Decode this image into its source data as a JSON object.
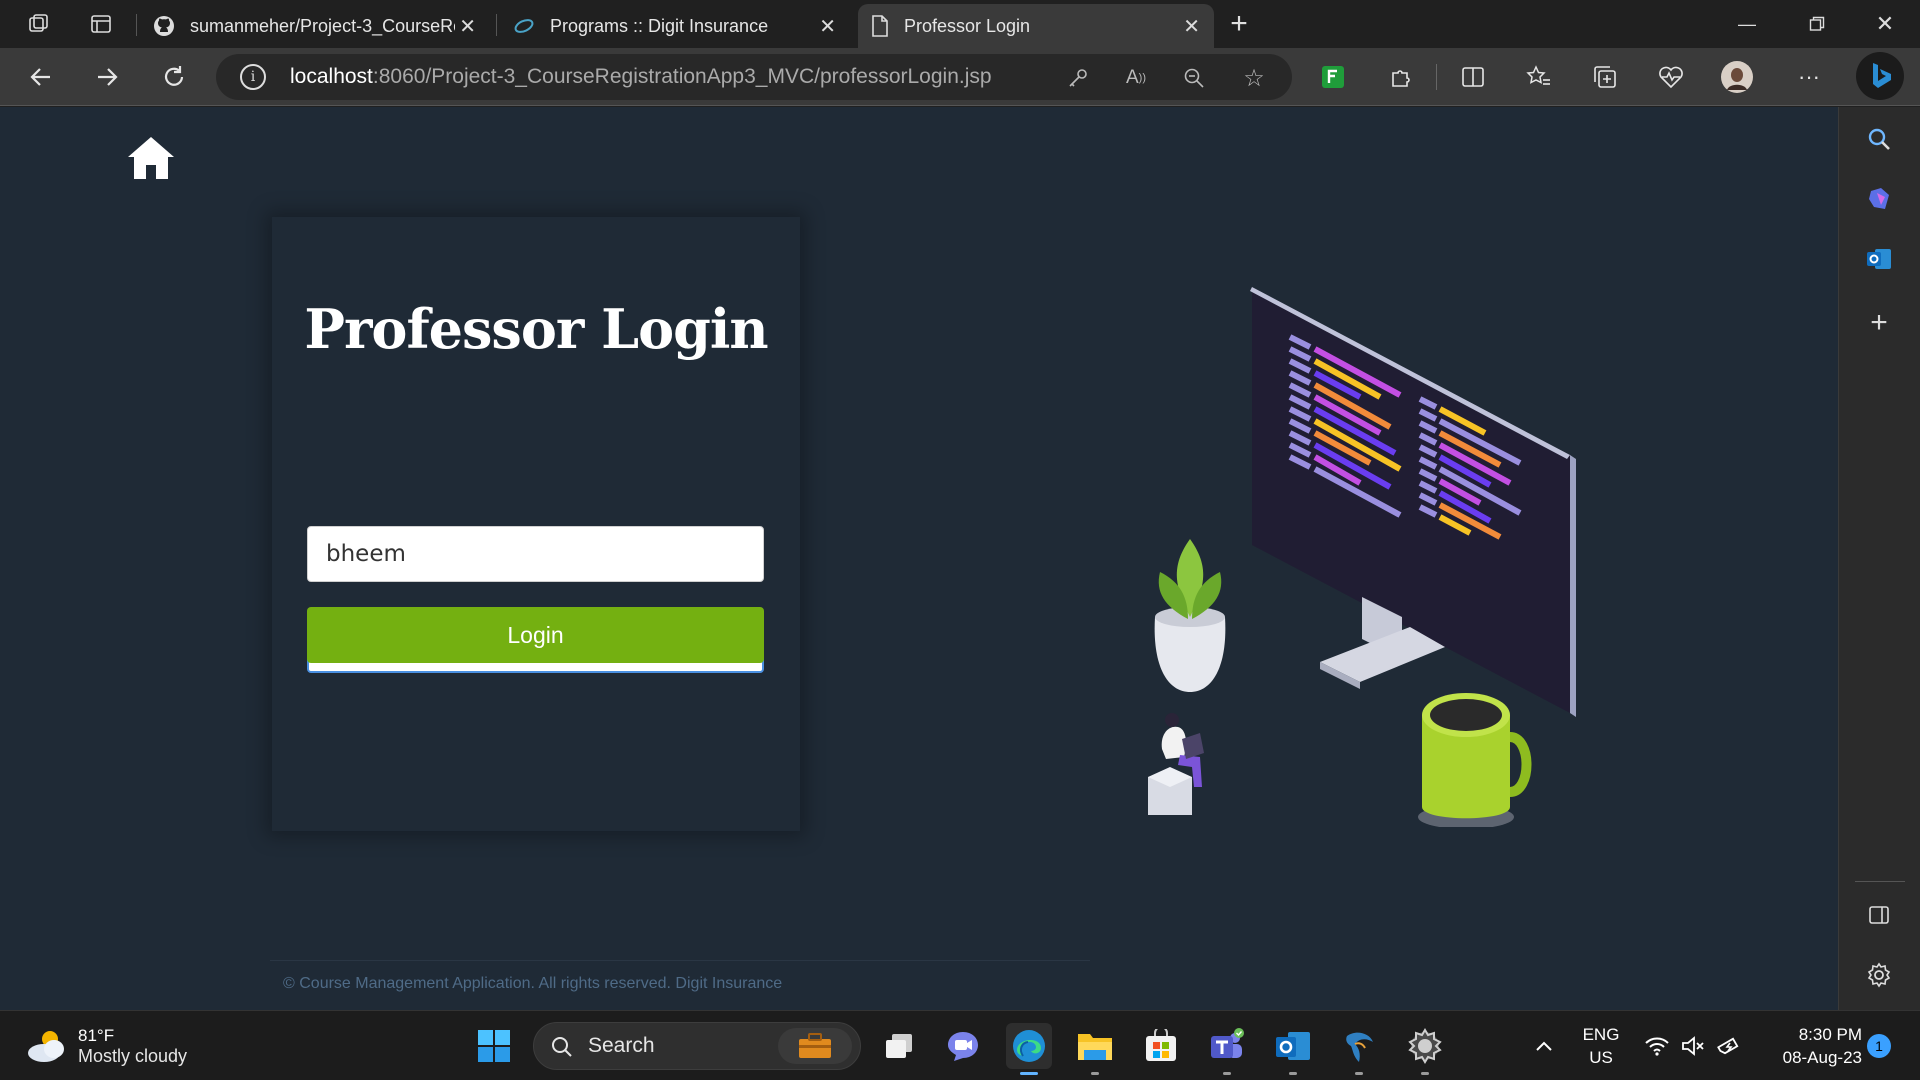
{
  "browser": {
    "tabs": [
      {
        "title": "sumanmeher/Project-3_CourseRe",
        "icon": "github-icon"
      },
      {
        "title": "Programs :: Digit Insurance",
        "icon": "site-icon"
      },
      {
        "title": "Professor Login",
        "icon": "page-icon",
        "active": true
      }
    ],
    "new_tab": "+",
    "url_host": "localhost",
    "url_path": ":8060/Project-3_CourseRegistrationApp3_MVC/professorLogin.jsp"
  },
  "page": {
    "title": "Professor Login",
    "username_value": "bheem",
    "password_value": "•••••",
    "login_label": "Login",
    "footer": "© Course Management Application. All rights reserved. Digit Insurance"
  },
  "taskbar": {
    "temperature": "81°F",
    "weather": "Mostly cloudy",
    "search_label": "Search",
    "lang_line1": "ENG",
    "lang_line2": "US",
    "time": "8:30 PM",
    "date": "08-Aug-23",
    "notification_count": "1"
  },
  "colors": {
    "page_bg": "#1f2a36",
    "login_button": "#74b011",
    "accent": "#4a90e2"
  }
}
